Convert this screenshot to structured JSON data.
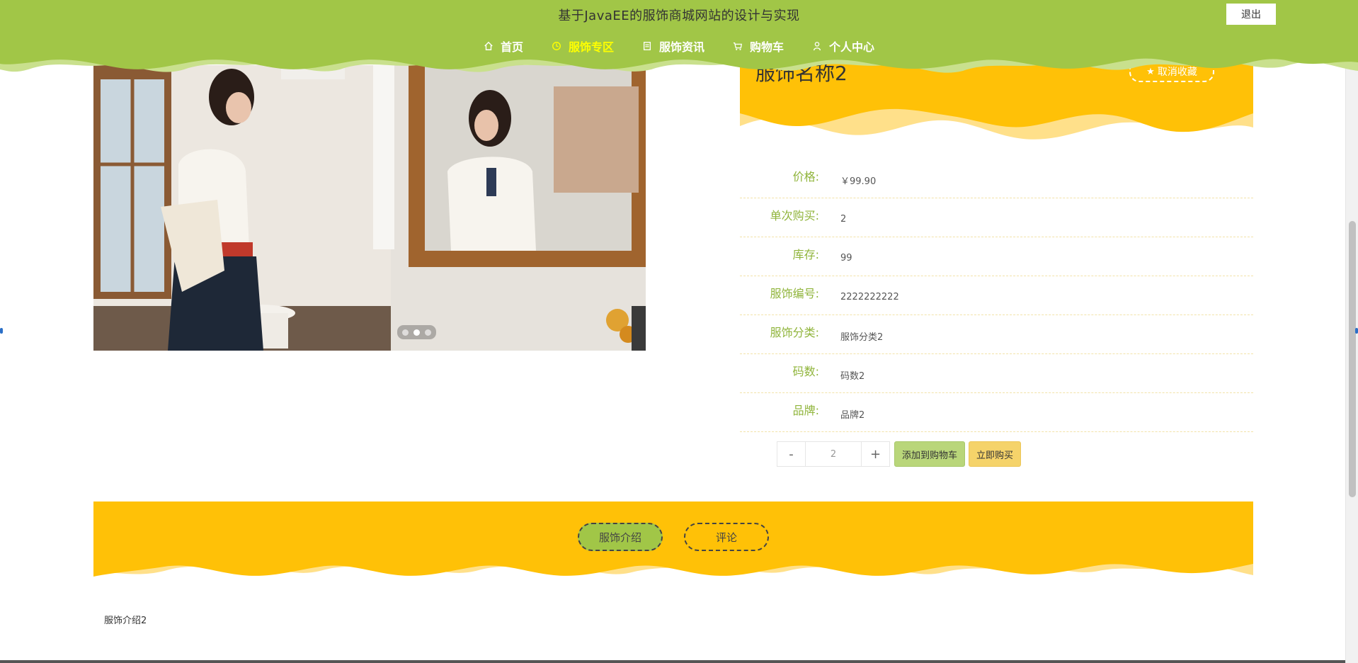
{
  "header": {
    "site_title": "基于JavaEE的服饰商城网站的设计与实现",
    "logout_label": "退出",
    "nav": [
      {
        "label": "首页",
        "icon": "home-icon",
        "active": false
      },
      {
        "label": "服饰专区",
        "icon": "clock-icon",
        "active": true
      },
      {
        "label": "服饰资讯",
        "icon": "news-icon",
        "active": false
      },
      {
        "label": "购物车",
        "icon": "cart-icon",
        "active": false
      },
      {
        "label": "个人中心",
        "icon": "user-icon",
        "active": false
      }
    ]
  },
  "product": {
    "name": "服饰名称2",
    "collect_label": "取消收藏",
    "details": [
      {
        "label": "价格:",
        "value": "￥99.90"
      },
      {
        "label": "单次购买:",
        "value": "2"
      },
      {
        "label": "库存:",
        "value": "99"
      },
      {
        "label": "服饰编号:",
        "value": "2222222222"
      },
      {
        "label": "服饰分类:",
        "value": "服饰分类2"
      },
      {
        "label": "码数:",
        "value": "码数2"
      },
      {
        "label": "品牌:",
        "value": "品牌2"
      }
    ],
    "quantity": "2",
    "minus_label": "-",
    "plus_label": "+",
    "add_cart_label": "添加到购物车",
    "buy_now_label": "立即购买"
  },
  "carousel": {
    "slides": 3,
    "active_index": 1
  },
  "tabs": [
    {
      "label": "服饰介绍",
      "active": true
    },
    {
      "label": "评论",
      "active": false
    }
  ],
  "intro_text": "服饰介绍2",
  "colors": {
    "header_green": "#a1c647",
    "accent_yellow": "#ffc107",
    "nav_active": "#ffff00",
    "label_green": "#8fb43a"
  }
}
